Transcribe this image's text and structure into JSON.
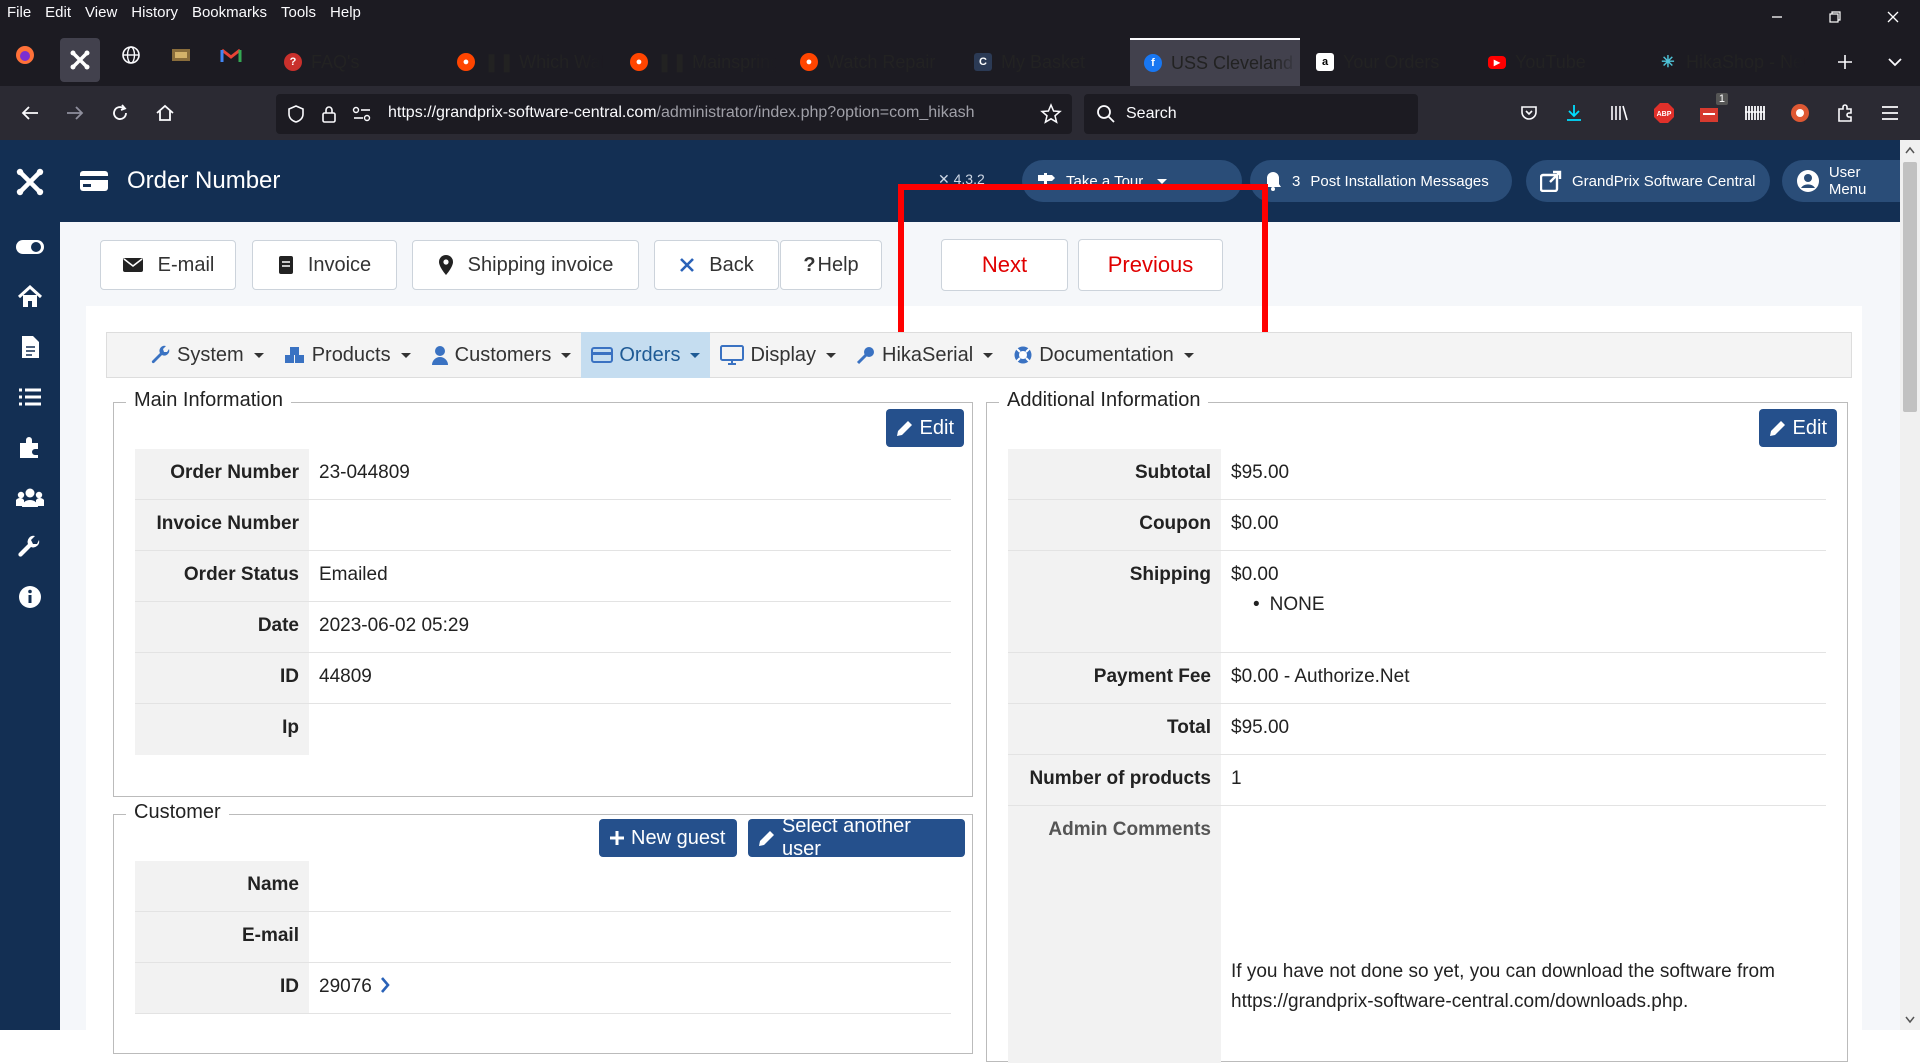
{
  "browser": {
    "menu": [
      "File",
      "Edit",
      "View",
      "History",
      "Bookmarks",
      "Tools",
      "Help"
    ],
    "tabs": [
      {
        "title": "FAQ's",
        "icon": "faq-favicon"
      },
      {
        "title": "❚❚ Which Watch H",
        "icon": "reddit-favicon"
      },
      {
        "title": "❚❚ Mainspring win",
        "icon": "reddit-favicon"
      },
      {
        "title": "Watch Repair",
        "icon": "reddit-favicon"
      },
      {
        "title": "My Basket",
        "icon": "c-favicon"
      },
      {
        "title": "USS Cleveland (LP",
        "icon": "facebook-favicon"
      },
      {
        "title": "Your Orders",
        "icon": "amazon-favicon"
      },
      {
        "title": "YouTube",
        "icon": "youtube-favicon"
      },
      {
        "title": "HikaShop - New T",
        "icon": "hikashop-favicon"
      }
    ],
    "url_host": "https://grandprix-software-central.com",
    "url_path": "/administrator/index.php?option=com_hikash",
    "search_placeholder": "Search",
    "extension_badge": "1"
  },
  "joomla": {
    "page_title": "Order Number",
    "version": "4.3.2",
    "take_tour": "Take a Tour",
    "messages_count": "3",
    "post_install": "Post Installation Messages",
    "site_link": "GrandPrix Software Central",
    "user_menu": "User Menu"
  },
  "toolbar": {
    "email": "E-mail",
    "invoice": "Invoice",
    "shipping_invoice": "Shipping invoice",
    "back": "Back",
    "help": "Help",
    "next": "Next",
    "previous": "Previous"
  },
  "nav": [
    "System",
    "Products",
    "Customers",
    "Orders",
    "Display",
    "HikaSerial",
    "Documentation"
  ],
  "main_info": {
    "legend": "Main Information",
    "edit": "Edit",
    "rows": [
      {
        "label": "Order Number",
        "value": "23-044809"
      },
      {
        "label": "Invoice Number",
        "value": ""
      },
      {
        "label": "Order Status",
        "value": "Emailed"
      },
      {
        "label": "Date",
        "value": "2023-06-02 05:29"
      },
      {
        "label": "ID",
        "value": "44809"
      },
      {
        "label": "Ip",
        "value": ""
      }
    ]
  },
  "customer": {
    "legend": "Customer",
    "new_guest": "New guest",
    "select_user": "Select another user",
    "rows": [
      {
        "label": "Name",
        "value": ""
      },
      {
        "label": "E-mail",
        "value": ""
      },
      {
        "label": "ID",
        "value": "29076"
      }
    ]
  },
  "additional": {
    "legend": "Additional Information",
    "edit": "Edit",
    "rows": [
      {
        "label": "Subtotal",
        "value": "$95.00"
      },
      {
        "label": "Coupon",
        "value": "$0.00"
      },
      {
        "label": "Shipping",
        "value": "$0.00",
        "sub": "NONE"
      },
      {
        "label": "Payment Fee",
        "value": "$0.00 - Authorize.Net"
      },
      {
        "label": "Total",
        "value": "$95.00"
      },
      {
        "label": "Number of products",
        "value": "1"
      },
      {
        "label": "Admin Comments",
        "value": ""
      }
    ],
    "comment_line1": "If you have not done so yet, you can download the software from",
    "comment_line2": "https://grandprix-software-central.com/downloads.php."
  }
}
